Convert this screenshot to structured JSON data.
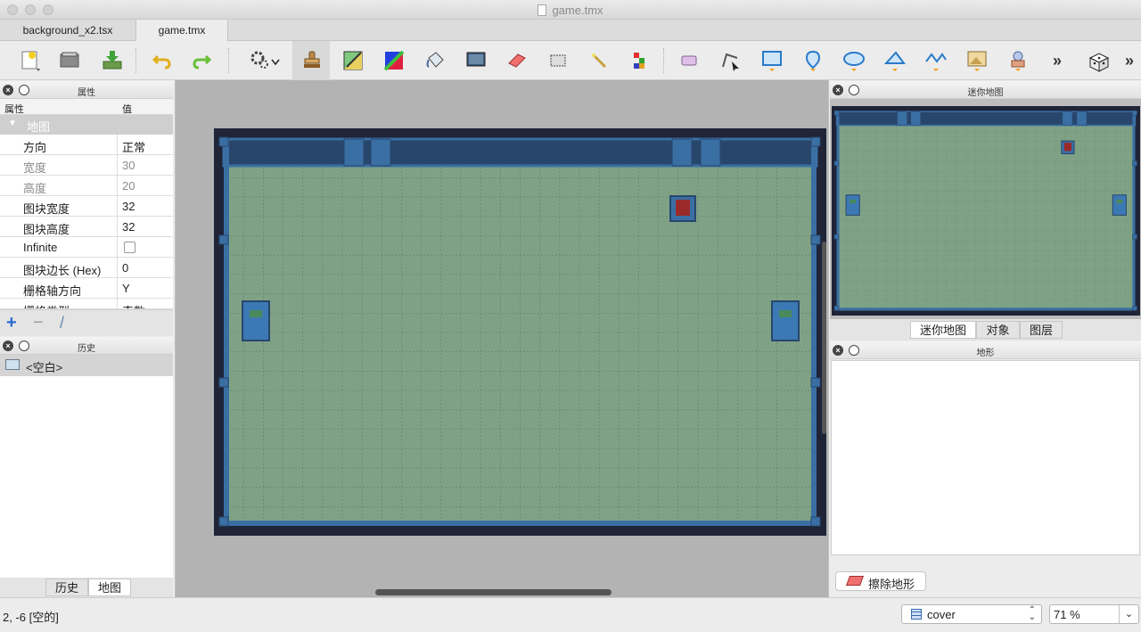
{
  "window": {
    "title": "game.tmx"
  },
  "tabs": [
    {
      "label": "background_x2.tsx",
      "active": false
    },
    {
      "label": "game.tmx",
      "active": true
    }
  ],
  "toolbar": {
    "tools": [
      "new-file-icon",
      "open-file-icon",
      "save-icon",
      "undo-icon",
      "redo-icon",
      "commands-icon",
      "stamp-brush-icon",
      "terrain-brush-icon",
      "wang-brush-icon",
      "bucket-fill-icon",
      "shape-fill-icon",
      "eraser-icon",
      "rectangular-select-icon",
      "magic-wand-icon",
      "select-same-tile-icon",
      "select-objects-icon",
      "edit-polygons-icon",
      "insert-rectangle-icon",
      "insert-point-icon",
      "insert-ellipse-icon",
      "insert-polygon-icon",
      "insert-polyline-icon",
      "insert-tile-icon",
      "insert-template-icon",
      "random-mode-icon"
    ],
    "more_label": "»",
    "active_tool": "stamp-brush-icon"
  },
  "properties_panel": {
    "title": "属性",
    "col_property": "属性",
    "col_value": "值",
    "category": "地图",
    "rows": [
      {
        "key": "方向",
        "value": "正常",
        "dim": false
      },
      {
        "key": "宽度",
        "value": "30",
        "dim": true
      },
      {
        "key": "高度",
        "value": "20",
        "dim": true
      },
      {
        "key": "图块宽度",
        "value": "32",
        "dim": false
      },
      {
        "key": "图块高度",
        "value": "32",
        "dim": false
      },
      {
        "key": "Infinite",
        "value": "",
        "checkbox": true,
        "checked": false,
        "dim": false
      },
      {
        "key": "图块边长 (Hex)",
        "value": "0",
        "dim": false
      },
      {
        "key": "栅格轴方向",
        "value": "Y",
        "dim": false
      },
      {
        "key": "栅格类型",
        "value": "奇数",
        "dim": false
      }
    ],
    "add_label": "+",
    "remove_label": "−",
    "edit_label": "/"
  },
  "history_panel": {
    "title": "历史",
    "items": [
      "<空白>"
    ],
    "tabs": [
      {
        "label": "历史",
        "active": false
      },
      {
        "label": "地图",
        "active": true
      }
    ]
  },
  "minimap_panel": {
    "title": "迷你地图",
    "tabs": [
      {
        "label": "迷你地图",
        "active": true
      },
      {
        "label": "对象",
        "active": false
      },
      {
        "label": "图层",
        "active": false
      }
    ]
  },
  "terrain_panel": {
    "title": "地形",
    "erase_label": "擦除地形"
  },
  "status_bar": {
    "coords": "2, -6 [空的]",
    "layer": "cover",
    "zoom": "71 %"
  },
  "map": {
    "columns": 30,
    "rows": 20,
    "colors": {
      "background": "#1f2437",
      "floor": "#7fa287",
      "wall": "#3a6fa4",
      "wall_dark": "#28466c",
      "grid": "#5f7f68",
      "enemy": "#3c79b4",
      "turret": "#9a2a2a"
    }
  }
}
